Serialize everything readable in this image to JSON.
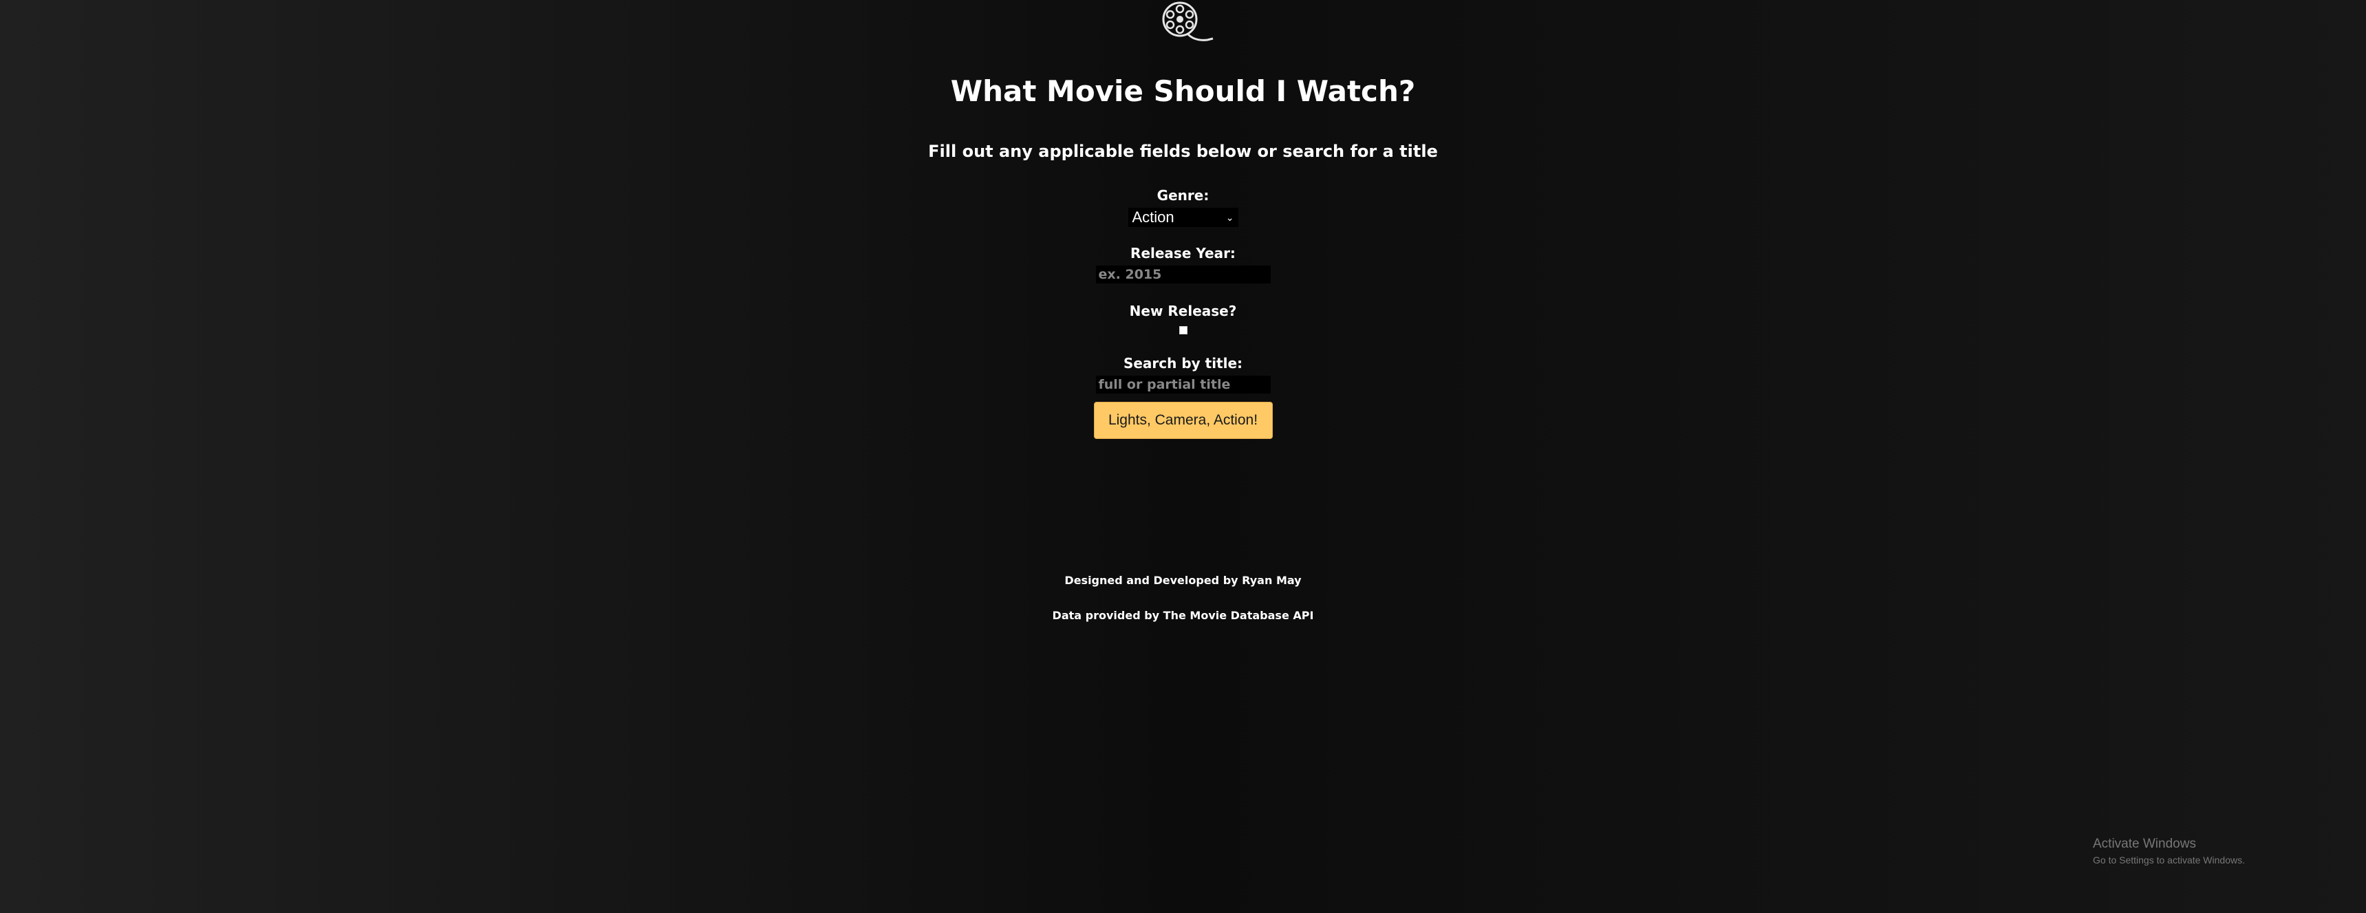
{
  "header": {
    "logo_icon": "film-reel-icon",
    "title": "What Movie Should I Watch?",
    "subtitle": "Fill out any applicable fields below or search for a title"
  },
  "form": {
    "genre": {
      "label": "Genre:",
      "selected": "Action"
    },
    "release_year": {
      "label": "Release Year:",
      "placeholder": "ex. 2015",
      "value": ""
    },
    "new_release": {
      "label": "New Release?",
      "checked": false
    },
    "search": {
      "label": "Search by title:",
      "placeholder": "full or partial title",
      "value": ""
    },
    "submit_label": "Lights, Camera, Action!"
  },
  "footer": {
    "credit_1": "Designed and Developed by Ryan May",
    "credit_2": "Data provided by The Movie Database API"
  },
  "os_watermark": {
    "title": "Activate Windows",
    "subtitle": "Go to Settings to activate Windows."
  },
  "colors": {
    "button_bg": "#ffc965",
    "page_bg": "#121212"
  }
}
